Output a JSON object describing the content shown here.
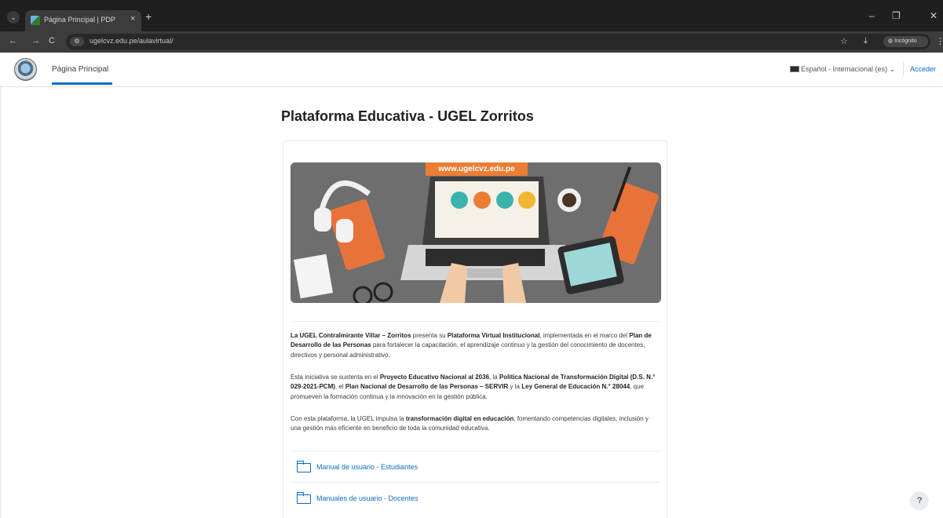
{
  "browser": {
    "tab_title": "Página Principal | PDP",
    "tab_close": "×",
    "new_tab": "+",
    "tab_menu": "⌄",
    "back": "←",
    "forward": "→",
    "reload": "C",
    "url": "ugelcvz.edu.pe/aulavirtual/",
    "bookmark": "☆",
    "download": "⤓",
    "incognito_label": "Incógnito",
    "menu": "⋮",
    "minimize": "–",
    "restore": "❐",
    "close": "✕"
  },
  "navbar": {
    "home_link": "Página Principal",
    "language": "Español - Internacional (es) ⌄",
    "login": "Acceder"
  },
  "main": {
    "title": "Plataforma Educativa - UGEL Zorritos",
    "banner_url": "www.ugelcvz.edu.pe",
    "paragraphs": [
      {
        "b1": "La UGEL Contralmirante Villar – Zorritos",
        "t1": " presenta su ",
        "b2": "Plataforma Virtual Institucional",
        "t2": ", implementada en el marco del ",
        "b3": "Plan de Desarrollo de las Personas",
        "t3": " para fortalecer la capacitación, el aprendizaje continuo y la gestión del conocimiento de docentes, directivos y personal administrativo."
      },
      {
        "t1": "Esta iniciativa se sustenta en el ",
        "b1": "Proyecto Educativo Nacional al 2036",
        "t2": ", la ",
        "b2": "Política Nacional de Transformación Digital (D.S. N.° 029-2021-PCM)",
        "t3": ", el ",
        "b3": "Plan Nacional de Desarrollo de las Personas – SERVIR",
        "t4": " y la ",
        "b4": "Ley General de Educación N.° 28044",
        "t5": ", que promueven la formación continua y la innovación en la gestión pública."
      },
      {
        "t1": "Con esta plataforma, la UGEL impulsa la ",
        "b1": "transformación digital en educación",
        "t2": ", fomentando competencias digitales, inclusión y una gestión más eficiente en beneficio de toda la comunidad educativa."
      }
    ],
    "resources": [
      {
        "label": "Manual de usuario - Estudiantes"
      },
      {
        "label": "Manuales de usuario - Docentes"
      }
    ]
  },
  "help": "?",
  "colors": {
    "brand": "#0f6cbf",
    "banner_accent": "#ec7d33",
    "chrome_dark": "#1f1f1f"
  }
}
